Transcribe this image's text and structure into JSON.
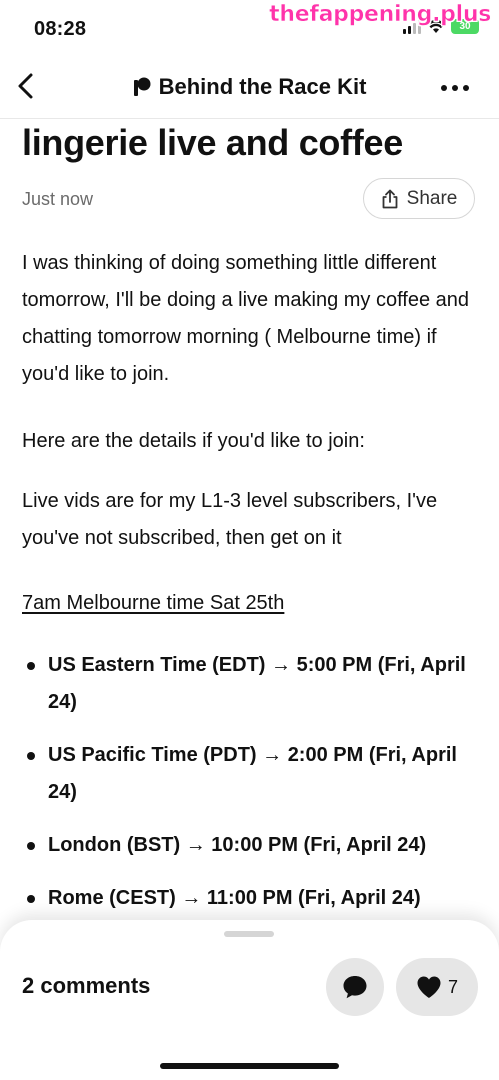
{
  "status_bar": {
    "time": "08:28",
    "battery": "30",
    "watermark": "thefappening.plus"
  },
  "nav": {
    "back_icon": "chevron-left-icon",
    "brand_icon": "patreon-icon",
    "title": "Behind the Race Kit",
    "more_icon": "ellipsis-icon"
  },
  "post": {
    "title": "lingerie live and coffee",
    "time": "Just now",
    "share_label": "Share",
    "paragraphs": [
      "I was thinking of doing something little different tomorrow, I'll be doing a live making my coffee and chatting tomorrow morning ( Melbourne time) if you'd like to join.",
      "Here are the details if you'd like to join:",
      "Live vids are for my L1-3 level subscribers, I've you've not subscribed, then get on it",
      "7am Melbourne time Sat 25th"
    ],
    "time_zones": [
      "US Eastern Time (EDT) → 5:00 PM (Fri, April 24)",
      "US Pacific Time (PDT) → 2:00 PM (Fri, April 24)",
      "London (BST) → 10:00 PM (Fri, April 24)",
      "Rome (CEST) → 11:00 PM (Fri, April 24)"
    ]
  },
  "bottom_bar": {
    "comments_label": "2 comments",
    "comment_icon": "chat-bubble-icon",
    "like_icon": "heart-icon",
    "like_count": "7"
  },
  "colors": {
    "watermark": "#ff33aa",
    "battery": "#4cd964",
    "muted_text": "#6b6b6b",
    "pill_bg": "#e6e6e6"
  }
}
